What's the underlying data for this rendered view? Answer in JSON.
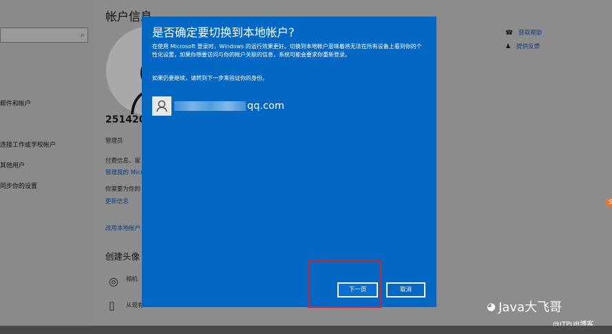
{
  "sidebar": {
    "search_icon": "search-icon",
    "items": [
      {
        "label": "邮件和帐户"
      },
      {
        "label": "连接工作或学校帐户"
      },
      {
        "label": "其他用户"
      },
      {
        "label": "同步你的设置"
      }
    ]
  },
  "page": {
    "title": "帐户信息",
    "account_name": "2514207",
    "role": "管理员",
    "payment_text": "付费信息、家",
    "manage_link": "管理我的 Micr",
    "verify_text": "你需要为你的",
    "update_link": "更新信息",
    "switch_local_link": "改用本地帐户",
    "create_avatar_title": "创建头像",
    "camera_label": "相机",
    "browse_label": "从现有"
  },
  "right_panel": {
    "get_help": "获取帮助",
    "feedback": "提供反馈"
  },
  "dialog": {
    "title": "是否确定要切换到本地帐户?",
    "body": "在使用 Microsoft 登录时，Windows 的运行效果更好。切换到本地帐户意味着将无法在所有设备上看到你的个性化设置，如果你想要访问与你的帐户关联的信息，系统可能会要求你重新登录。",
    "hint": "如果仍要继续，请转到下一步来验证你的身份。",
    "email_visible": "qq.com",
    "next_button": "下一页",
    "cancel_button": "取消"
  },
  "watermark": {
    "main": "Java大飞哥",
    "sub": "@ITPUB博客"
  },
  "colors": {
    "dialog_bg": "#0368c3",
    "highlight": "#e02020",
    "link": "#0b3f80"
  }
}
